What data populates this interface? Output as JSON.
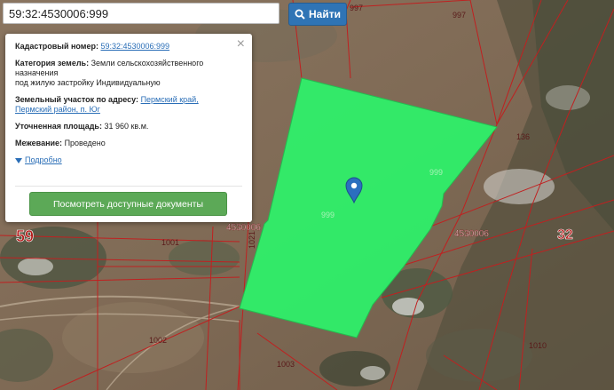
{
  "search": {
    "value": "59:32:4530006:999",
    "button_label": "Найти"
  },
  "popup": {
    "cadastral_label": "Кадастровый номер:",
    "cadastral_value": "59:32:4530006:999",
    "category_label": "Категория земель:",
    "category_line1": "Земли сельскохозяйственного",
    "category_line2": "назначения",
    "category_line3": "под жилую застройку Индивидуальную",
    "address_label": "Земельный участок по адресу:",
    "address_line1": "Пермский край,",
    "address_line2": "Пермский район, п. Юг",
    "area_label": "Уточненная площадь:",
    "area_value": "31 960 кв.м.",
    "survey_label": "Межевание:",
    "survey_value": "Проведено",
    "more_label": "Подробно",
    "docs_button": "Посмотреть доступные документы"
  },
  "map": {
    "parcel_color": "#2ff06a",
    "labels": {
      "n997a": "997",
      "n997b": "997",
      "n136": "136",
      "n999a": "999",
      "n999b": "999",
      "quarter_right": "4530006",
      "quarter_left": "4530006",
      "n1021": "1021",
      "n1001": "1001",
      "n1002": "1002",
      "n1003": "1003",
      "n1010": "1010",
      "district_left": "59",
      "district_right": "32"
    }
  }
}
